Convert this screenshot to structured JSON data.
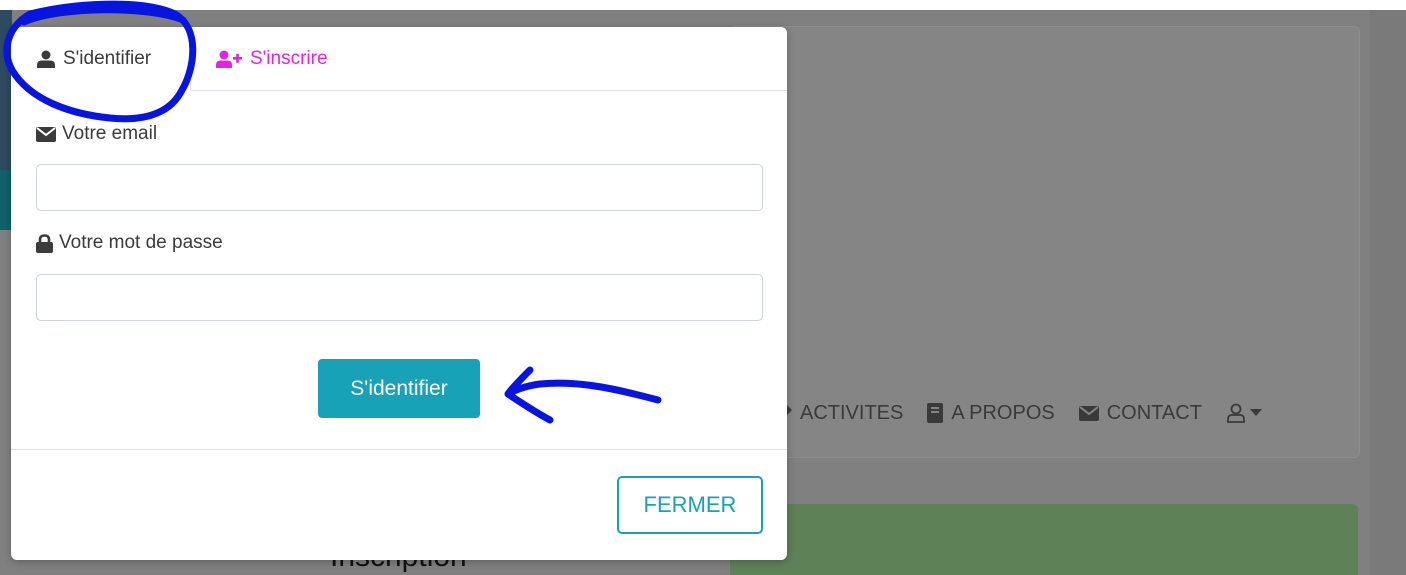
{
  "background": {
    "nav": {
      "items": [
        {
          "label": "ACTIVITES",
          "icon": "activities-icon"
        },
        {
          "label": "A PROPOS",
          "icon": "book-icon"
        },
        {
          "label": "CONTACT",
          "icon": "envelope-icon"
        }
      ],
      "user_icon": "user-outline-icon"
    },
    "banner_text": "Inscription"
  },
  "modal": {
    "tabs": {
      "login_label": "S'identifier",
      "register_label": "S'inscrire"
    },
    "email": {
      "label": "Votre email",
      "value": "",
      "placeholder": ""
    },
    "password": {
      "label": "Votre mot de passe",
      "value": "",
      "placeholder": ""
    },
    "submit_label": "S'identifier",
    "close_label": "FERMER"
  },
  "colors": {
    "accent": "#17a2b8",
    "register_tab": "#e024e0",
    "annotation": "#0a14e0",
    "overlay": "#808080"
  }
}
